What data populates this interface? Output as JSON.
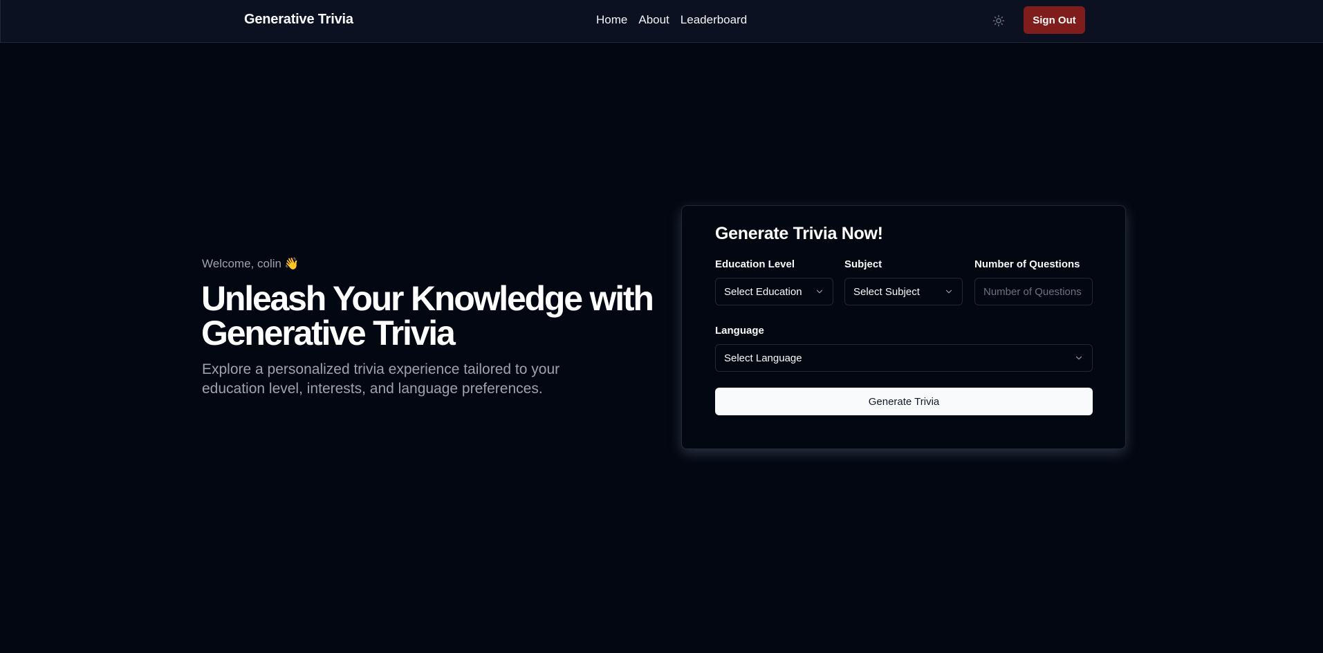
{
  "header": {
    "brand": "Generative Trivia",
    "nav": [
      "Home",
      "About",
      "Leaderboard"
    ],
    "theme_icon": "sun-icon",
    "signout_label": "Sign Out",
    "signout_color": "#7f1d1d"
  },
  "hero": {
    "welcome": "Welcome, colin",
    "welcome_emoji": "👋",
    "title": "Unleash Your Knowledge with Generative Trivia",
    "subtitle": "Explore a personalized trivia experience tailored to your education level, interests, and language preferences."
  },
  "form": {
    "title": "Generate Trivia Now!",
    "education": {
      "label": "Education Level",
      "value": "Select Education"
    },
    "subject": {
      "label": "Subject",
      "value": "Select Subject"
    },
    "questions": {
      "label": "Number of Questions",
      "placeholder": "Number of Questions"
    },
    "language": {
      "label": "Language",
      "value": "Select Language"
    },
    "submit_label": "Generate Trivia"
  },
  "colors": {
    "background": "#030712",
    "navbar": "#0b1120",
    "primary_button": "#f9fafb"
  }
}
